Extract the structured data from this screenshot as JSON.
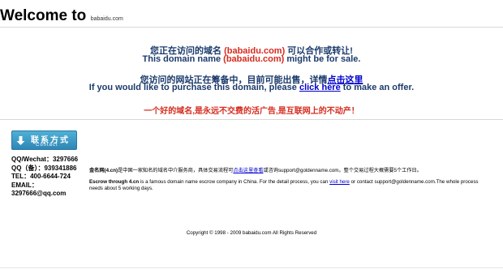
{
  "header": {
    "welcome": "Welcome to",
    "domain": "babaidu.com"
  },
  "notice": {
    "line1_prefix": "您正在访问的域名 ",
    "line1_domain": "(babaidu.com)",
    "line1_suffix": " 可以合作或转让!",
    "line2_prefix": "This domain name ",
    "line2_domain": "(babaidu.com)",
    "line2_suffix": "  might be for sale.",
    "line3_prefix": "您访问的网站正在筹备中，目前可能出售，详情",
    "line3_link": "点击这里",
    "line4_prefix": "If you would like to purchase this domain, please ",
    "line4_link": "click here",
    "line4_suffix": " to make an offer.",
    "slogan": "一个好的域名,是永远不交费的活广告,是互联网上的不动产！"
  },
  "contact": {
    "button_zh": "联系方式",
    "button_en": "Contact",
    "rows": [
      "QQ/Wechat：3297666",
      "QQ（备）：939341886",
      "TEL：400-6644-724",
      "EMAIL：",
      "3297666@qq.com"
    ]
  },
  "info": {
    "p1_bold": "金名网(4.cn)",
    "p1_text": "是中国一家知名的域名中介服务商，具体交易流程可",
    "p1_link": "点击这里查看",
    "p1_rest": "或咨询support@goldenname.com。整个交易过程大概需要5个工作日。",
    "p2_bold": "Escrow through 4.cn",
    "p2_text": " is a famous domain name escrow company in China. For the detail process, you can ",
    "p2_link": "visit here",
    "p2_rest": " or contact support@goldenname.com.The whole process needs about 5 working days."
  },
  "footer": {
    "copyright": "Copyright © 1998 - 2009 babaidu.com All Rights Reserved"
  },
  "colors": {
    "navy_text": "#1b3a6b",
    "red": "#d52b1e",
    "link": "#0000cc",
    "button": "#2f86b5"
  }
}
